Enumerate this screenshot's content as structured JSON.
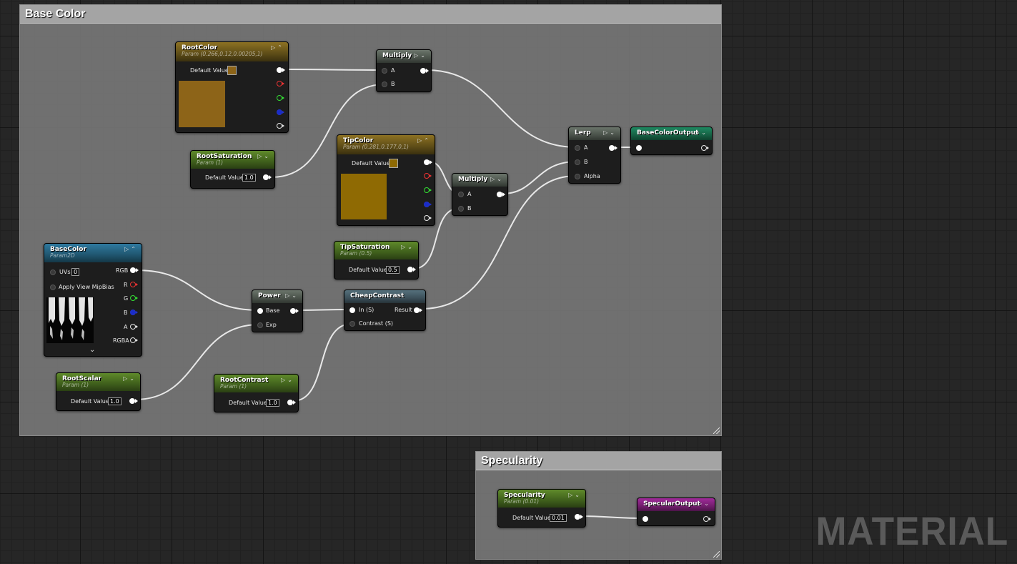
{
  "comments": {
    "base_color": "Base Color",
    "specularity": "Specularity"
  },
  "nodes": {
    "root_color": {
      "title": "RootColor",
      "subtitle": "Param (0.266,0.12,0.00205,1)",
      "default_label": "Default Value",
      "swatch_color": "#8d6418"
    },
    "root_saturation": {
      "title": "RootSaturation",
      "subtitle": "Param (1)",
      "default_label": "Default Value",
      "value": "1.0"
    },
    "multiply_1": {
      "title": "Multiply",
      "pin_a": "A",
      "pin_b": "B"
    },
    "tip_color": {
      "title": "TipColor",
      "subtitle": "Param (0.281,0.177,0,1)",
      "default_label": "Default Value",
      "swatch_color": "#8f6a03"
    },
    "multiply_2": {
      "title": "Multiply",
      "pin_a": "A",
      "pin_b": "B"
    },
    "tip_saturation": {
      "title": "TipSaturation",
      "subtitle": "Param (0.5)",
      "default_label": "Default Value",
      "value": "0.5"
    },
    "lerp": {
      "title": "Lerp",
      "pin_a": "A",
      "pin_b": "B",
      "pin_alpha": "Alpha"
    },
    "base_color_output": {
      "title": "BaseColorOutput"
    },
    "base_color_tex": {
      "title": "BaseColor",
      "subtitle": "Param2D",
      "uvs_label": "UVs",
      "uvs_value": "0",
      "mip_label": "Apply View MipBias",
      "out_rgb": "RGB",
      "out_r": "R",
      "out_g": "G",
      "out_b": "B",
      "out_a": "A",
      "out_rgba": "RGBA"
    },
    "power": {
      "title": "Power",
      "pin_base": "Base",
      "pin_exp": "Exp"
    },
    "cheap_contrast": {
      "title": "CheapContrast",
      "pin_in": "In (S)",
      "pin_contrast": "Contrast (S)",
      "pin_result": "Result"
    },
    "root_scalar": {
      "title": "RootScalar",
      "subtitle": "Param (1)",
      "default_label": "Default Value",
      "value": "1.0"
    },
    "root_contrast": {
      "title": "RootContrast",
      "subtitle": "Param (1)",
      "default_label": "Default Value",
      "value": "1.0"
    },
    "specularity": {
      "title": "Specularity",
      "subtitle": "Param (0.01)",
      "default_label": "Default Value",
      "value": "0.01"
    },
    "specular_output": {
      "title": "SpecularOutput"
    }
  },
  "watermark": "MATERIAL",
  "icons": {
    "preview_toggle": "circle-arrow-icon",
    "collapse": "chevron-icon",
    "expand": "chevron-down-icon"
  }
}
